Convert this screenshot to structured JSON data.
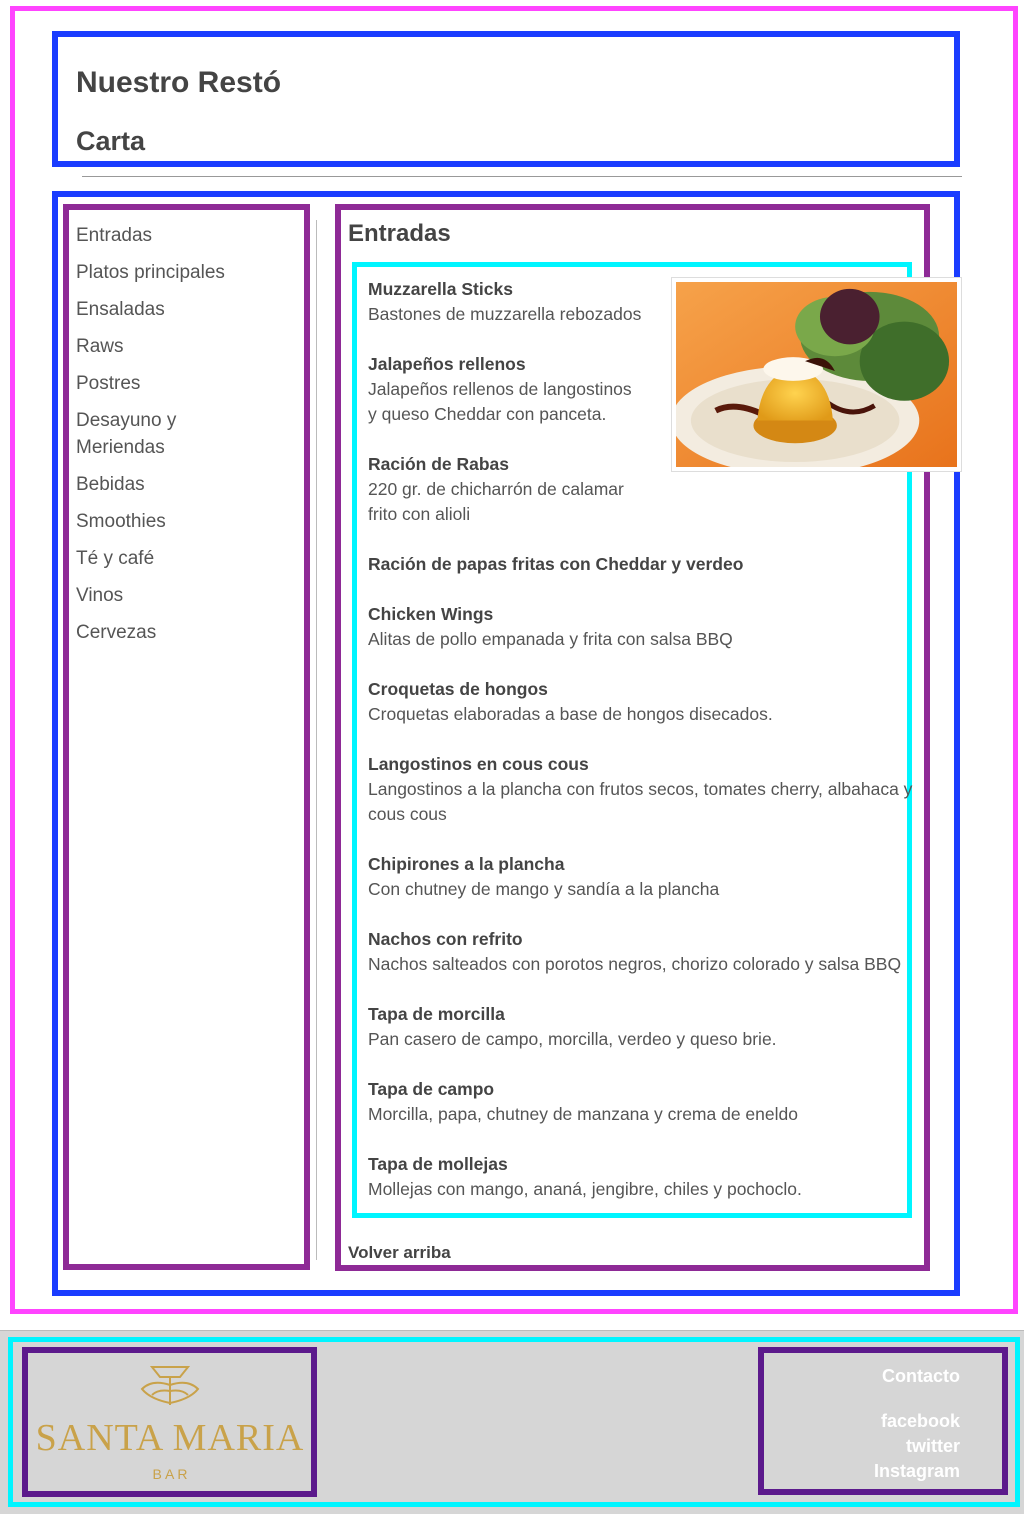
{
  "header": {
    "site_title": "Nuestro Restó",
    "page_title": "Carta"
  },
  "sidebar": {
    "items": [
      {
        "label": "Entradas"
      },
      {
        "label": "Platos principales"
      },
      {
        "label": "Ensaladas"
      },
      {
        "label": "Raws"
      },
      {
        "label": "Postres"
      },
      {
        "label": "Desayuno y Meriendas"
      },
      {
        "label": "Bebidas"
      },
      {
        "label": "Smoothies"
      },
      {
        "label": "Té y café"
      },
      {
        "label": "Vinos"
      },
      {
        "label": "Cervezas"
      }
    ]
  },
  "main": {
    "section_title": "Entradas",
    "image_icon": "food-photo",
    "dishes": [
      {
        "name": "Muzzarella Sticks",
        "desc": [
          "Bastones de muzzarella rebozados"
        ]
      },
      {
        "name": "Jalapeños rellenos",
        "desc": [
          "Jalapeños rellenos de langostinos",
          "y queso Cheddar con panceta."
        ]
      },
      {
        "name": "Ración de Rabas",
        "desc": [
          "220 gr. de chicharrón de calamar",
          "frito con alioli"
        ]
      },
      {
        "name": "Ración de papas fritas con Cheddar y verdeo",
        "desc": []
      },
      {
        "name": "Chicken Wings",
        "desc": [
          "Alitas de pollo empanada y frita con salsa BBQ"
        ]
      },
      {
        "name": "Croquetas de hongos",
        "desc": [
          "Croquetas elaboradas a base de hongos disecados."
        ]
      },
      {
        "name": "Langostinos en cous cous",
        "desc": [
          "Langostinos a la plancha con frutos secos, tomates cherry, albahaca y",
          "cous cous"
        ]
      },
      {
        "name": "Chipirones a la plancha",
        "desc": [
          "Con chutney de mango y sandía a la plancha"
        ]
      },
      {
        "name": "Nachos con refrito",
        "desc": [
          "Nachos salteados con porotos negros, chorizo colorado y salsa BBQ"
        ]
      },
      {
        "name": "Tapa de morcilla",
        "desc": [
          "Pan casero de campo, morcilla, verdeo y queso brie."
        ]
      },
      {
        "name": "Tapa de campo",
        "desc": [
          "Morcilla, papa, chutney de manzana y crema de eneldo"
        ]
      },
      {
        "name": "Tapa de mollejas",
        "desc": [
          "Mollejas con mango, ananá, jengibre, chiles y pochoclo."
        ]
      }
    ],
    "back_to_top": "Volver arriba"
  },
  "footer": {
    "logo": {
      "name": "SANTA MARIA",
      "tagline": "B A R"
    },
    "contact_label": "Contacto",
    "links": [
      {
        "label": "facebook"
      },
      {
        "label": "twitter"
      },
      {
        "label": "Instagram"
      }
    ]
  },
  "colors": {
    "outer_frame": "#ff44ff",
    "section_frame": "#1a3cff",
    "column_frame": "#8e2a96",
    "list_frame": "#00f5ff",
    "footer_inner_frame": "#5c1a8c",
    "footer_bg": "#d6d6d6",
    "logo_gold": "#c9a24a",
    "text": "#444444"
  }
}
